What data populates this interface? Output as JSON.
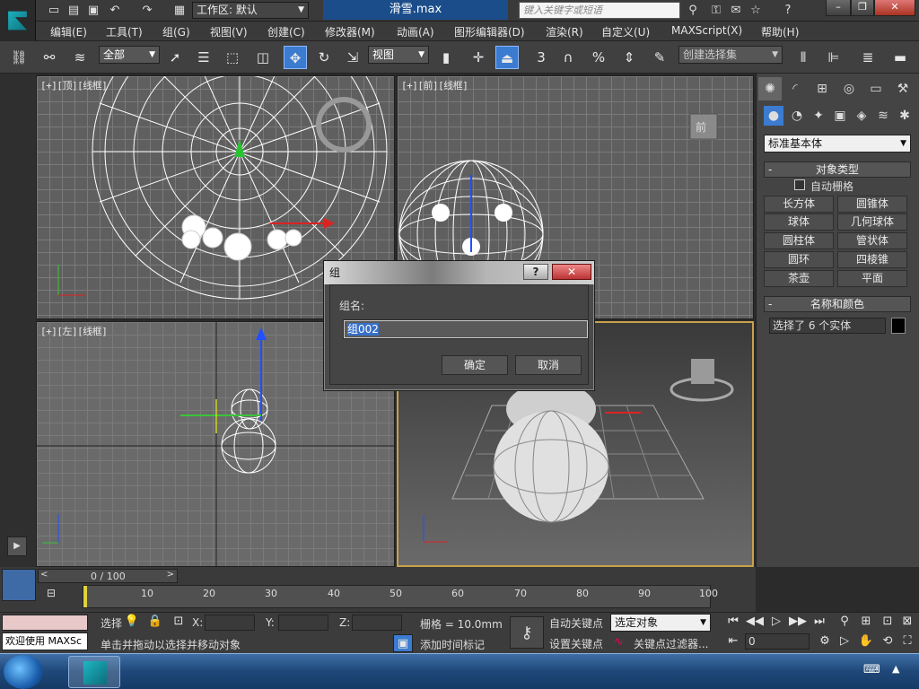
{
  "window": {
    "title": "滑雪.max",
    "workspace": "工作区: 默认",
    "search_placeholder": "键入关键字或短语"
  },
  "menu": [
    "编辑(E)",
    "工具(T)",
    "组(G)",
    "视图(V)",
    "创建(C)",
    "修改器(M)",
    "动画(A)",
    "图形编辑器(D)",
    "渲染(R)",
    "自定义(U)",
    "MAXScript(X)",
    "帮助(H)"
  ],
  "toolbar": {
    "filter": "全部",
    "ref_coord": "视图",
    "named_selection": "创建选择集",
    "snap_num": "3",
    "percent": "%"
  },
  "viewports": {
    "top_label": "[+][顶][线框]",
    "front_label": "[+][前][线框]",
    "left_label": "[+][左][线框]",
    "viewcube_front": "前"
  },
  "command_panel": {
    "category": "标准基本体",
    "rollout_object_type": "对象类型",
    "autogrid": "自动栅格",
    "objects": [
      "长方体",
      "圆锥体",
      "球体",
      "几何球体",
      "圆柱体",
      "管状体",
      "圆环",
      "四棱锥",
      "茶壶",
      "平面"
    ],
    "rollout_name_color": "名称和颜色",
    "name_value": "选择了 6 个实体",
    "name_color": "#000000"
  },
  "dialog": {
    "title": "组",
    "label": "组名:",
    "value": "组002",
    "ok": "确定",
    "cancel": "取消"
  },
  "timeline": {
    "frame_display": "0 / 100",
    "ticks": [
      "10",
      "20",
      "30",
      "40",
      "50",
      "60",
      "70",
      "80",
      "90",
      "100"
    ]
  },
  "status": {
    "selection_prefix": "选择",
    "welcome": "欢迎使用 MAXSc",
    "prompt": "单击并拖动以选择并移动对象",
    "x_label": "X:",
    "y_label": "Y:",
    "z_label": "Z:",
    "grid": "栅格 = 10.0mm",
    "auto_key": "自动关键点",
    "set_key": "设置关键点",
    "add_time_tag": "添加时间标记",
    "key_mode": "选定对象",
    "key_filters": "关键点过滤器...",
    "frame_value": "0"
  },
  "colors": {
    "accent": "#3b7bd0",
    "active_viewport_border": "#c8a24a",
    "title_active": "#1b4d8a"
  }
}
